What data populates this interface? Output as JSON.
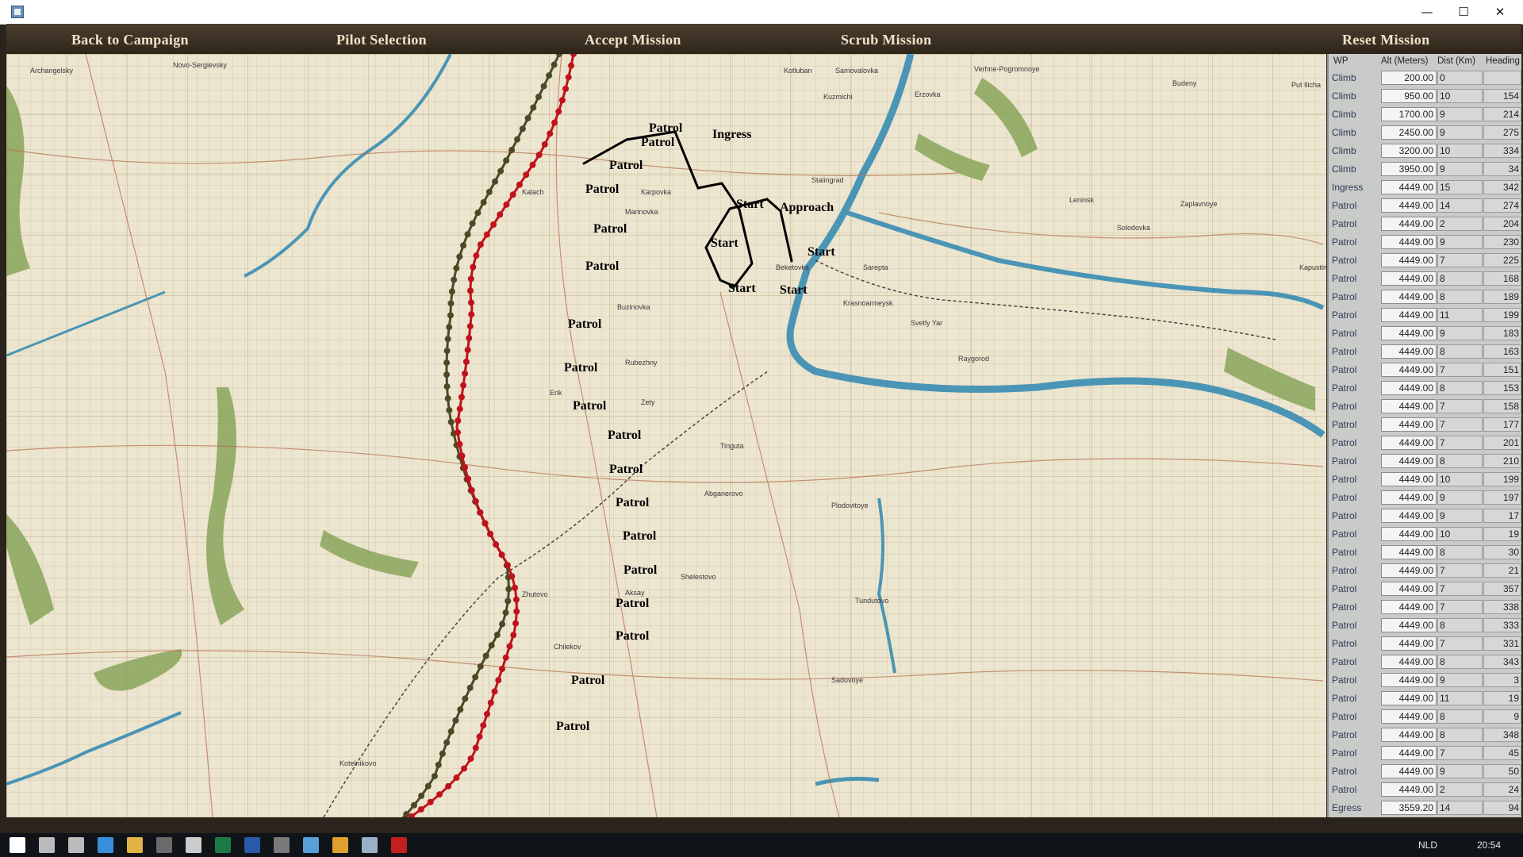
{
  "window": {
    "minimize": "—",
    "maximize": "☐",
    "close": "✕"
  },
  "menu": {
    "back": "Back to Campaign",
    "pilot": "Pilot Selection",
    "accept": "Accept Mission",
    "scrub": "Scrub Mission",
    "reset": "Reset Mission"
  },
  "map": {
    "colors": {
      "river": "#4a95b5",
      "forest": "#8aa55a",
      "route_red": "#c0121b",
      "route_olive": "#4a4a26"
    },
    "labels": {
      "patrol": "Patrol",
      "start": "Start",
      "ingress": "Ingress",
      "approach": "Approach"
    },
    "towns": [
      "Archangelsky",
      "Novo-Sergievsky",
      "Kotluban",
      "Samovalovka",
      "Kuzmichi",
      "Erzovka",
      "Verhne-Pogromnoye",
      "Budeny",
      "Put Ilicha",
      "Kalach",
      "Karpovka",
      "Marinovka",
      "Stalingrad",
      "Beketovka",
      "Krasnoarmeysk",
      "Sarepta",
      "Leninsk",
      "Zaplavnoye",
      "Tundutovo",
      "Abganerovo",
      "Chilekov",
      "Sadovoye",
      "Kotelnikovo",
      "Plodovitoye",
      "Kapustin Yar",
      "Solodovka",
      "Svetly Yar",
      "Raygorod",
      "Tinguta",
      "Shelestovo",
      "Aksay",
      "Zhutovo",
      "Erik",
      "Zety",
      "Rubezhny",
      "Buzinovka"
    ]
  },
  "panel": {
    "headers": {
      "wp": "WP",
      "alt": "Alt (Meters)",
      "dist": "Dist (Km)",
      "heading": "Heading"
    },
    "rows": [
      {
        "type": "Climb",
        "alt": "200.00",
        "dist": "0",
        "heading": ""
      },
      {
        "type": "Climb",
        "alt": "950.00",
        "dist": "10",
        "heading": "154"
      },
      {
        "type": "Climb",
        "alt": "1700.00",
        "dist": "9",
        "heading": "214"
      },
      {
        "type": "Climb",
        "alt": "2450.00",
        "dist": "9",
        "heading": "275"
      },
      {
        "type": "Climb",
        "alt": "3200.00",
        "dist": "10",
        "heading": "334"
      },
      {
        "type": "Climb",
        "alt": "3950.00",
        "dist": "9",
        "heading": "34"
      },
      {
        "type": "Ingress",
        "alt": "4449.00",
        "dist": "15",
        "heading": "342"
      },
      {
        "type": "Patrol",
        "alt": "4449.00",
        "dist": "14",
        "heading": "274"
      },
      {
        "type": "Patrol",
        "alt": "4449.00",
        "dist": "2",
        "heading": "204"
      },
      {
        "type": "Patrol",
        "alt": "4449.00",
        "dist": "9",
        "heading": "230"
      },
      {
        "type": "Patrol",
        "alt": "4449.00",
        "dist": "7",
        "heading": "225"
      },
      {
        "type": "Patrol",
        "alt": "4449.00",
        "dist": "8",
        "heading": "168"
      },
      {
        "type": "Patrol",
        "alt": "4449.00",
        "dist": "8",
        "heading": "189"
      },
      {
        "type": "Patrol",
        "alt": "4449.00",
        "dist": "11",
        "heading": "199"
      },
      {
        "type": "Patrol",
        "alt": "4449.00",
        "dist": "9",
        "heading": "183"
      },
      {
        "type": "Patrol",
        "alt": "4449.00",
        "dist": "8",
        "heading": "163"
      },
      {
        "type": "Patrol",
        "alt": "4449.00",
        "dist": "7",
        "heading": "151"
      },
      {
        "type": "Patrol",
        "alt": "4449.00",
        "dist": "8",
        "heading": "153"
      },
      {
        "type": "Patrol",
        "alt": "4449.00",
        "dist": "7",
        "heading": "158"
      },
      {
        "type": "Patrol",
        "alt": "4449.00",
        "dist": "7",
        "heading": "177"
      },
      {
        "type": "Patrol",
        "alt": "4449.00",
        "dist": "7",
        "heading": "201"
      },
      {
        "type": "Patrol",
        "alt": "4449.00",
        "dist": "8",
        "heading": "210"
      },
      {
        "type": "Patrol",
        "alt": "4449.00",
        "dist": "10",
        "heading": "199"
      },
      {
        "type": "Patrol",
        "alt": "4449.00",
        "dist": "9",
        "heading": "197"
      },
      {
        "type": "Patrol",
        "alt": "4449.00",
        "dist": "9",
        "heading": "17"
      },
      {
        "type": "Patrol",
        "alt": "4449.00",
        "dist": "10",
        "heading": "19"
      },
      {
        "type": "Patrol",
        "alt": "4449.00",
        "dist": "8",
        "heading": "30"
      },
      {
        "type": "Patrol",
        "alt": "4449.00",
        "dist": "7",
        "heading": "21"
      },
      {
        "type": "Patrol",
        "alt": "4449.00",
        "dist": "7",
        "heading": "357"
      },
      {
        "type": "Patrol",
        "alt": "4449.00",
        "dist": "7",
        "heading": "338"
      },
      {
        "type": "Patrol",
        "alt": "4449.00",
        "dist": "8",
        "heading": "333"
      },
      {
        "type": "Patrol",
        "alt": "4449.00",
        "dist": "7",
        "heading": "331"
      },
      {
        "type": "Patrol",
        "alt": "4449.00",
        "dist": "8",
        "heading": "343"
      },
      {
        "type": "Patrol",
        "alt": "4449.00",
        "dist": "9",
        "heading": "3"
      },
      {
        "type": "Patrol",
        "alt": "4449.00",
        "dist": "11",
        "heading": "19"
      },
      {
        "type": "Patrol",
        "alt": "4449.00",
        "dist": "8",
        "heading": "9"
      },
      {
        "type": "Patrol",
        "alt": "4449.00",
        "dist": "8",
        "heading": "348"
      },
      {
        "type": "Patrol",
        "alt": "4449.00",
        "dist": "7",
        "heading": "45"
      },
      {
        "type": "Patrol",
        "alt": "4449.00",
        "dist": "9",
        "heading": "50"
      },
      {
        "type": "Patrol",
        "alt": "4449.00",
        "dist": "2",
        "heading": "24"
      },
      {
        "type": "Egress",
        "alt": "3559.20",
        "dist": "14",
        "heading": "94"
      }
    ]
  },
  "taskbar": {
    "language": "NLD",
    "time": "20:54",
    "icons": [
      "windows-start-icon",
      "search-icon",
      "task-view-icon",
      "edge-icon",
      "file-explorer-icon",
      "store-icon",
      "calculator-icon",
      "excel-icon",
      "word-icon",
      "game-icon",
      "app-icon",
      "chrome-icon",
      "active-app-icon",
      "star-app-icon"
    ]
  }
}
